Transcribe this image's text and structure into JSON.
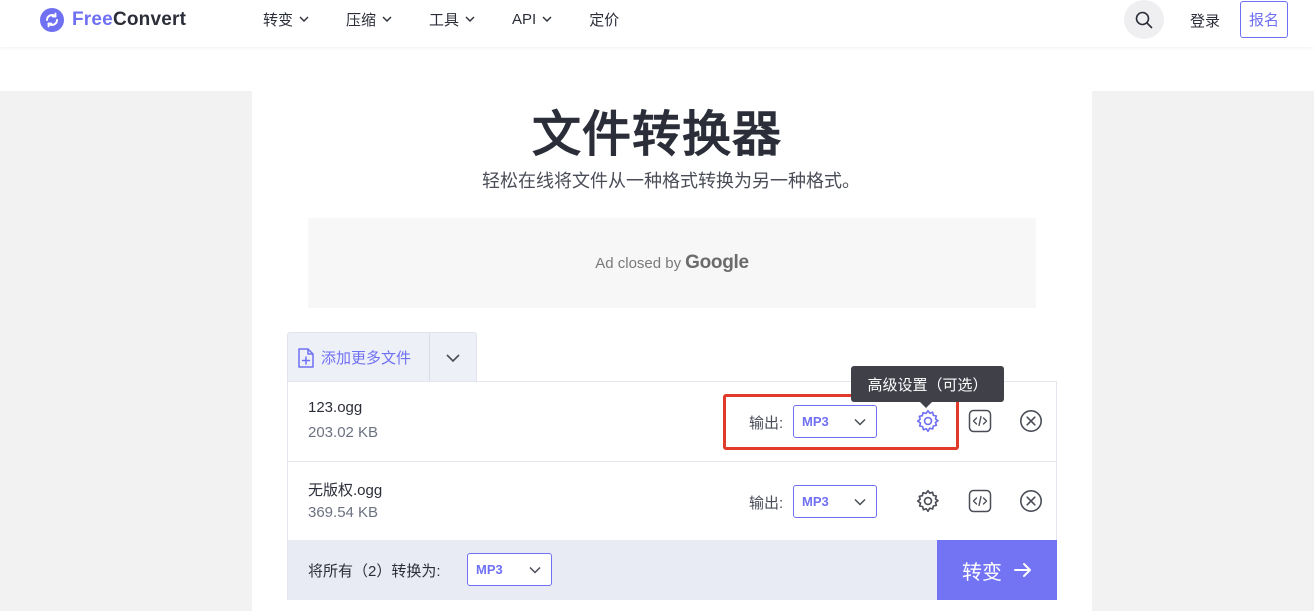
{
  "header": {
    "logo_free": "Free",
    "logo_convert": "Convert",
    "nav": [
      {
        "label": "转变"
      },
      {
        "label": "压缩"
      },
      {
        "label": "工具"
      },
      {
        "label": "API"
      },
      {
        "label": "定价"
      }
    ],
    "login": "登录",
    "signup": "报名"
  },
  "hero": {
    "title": "文件转换器",
    "subtitle": "轻松在线将文件从一种格式转换为另一种格式。"
  },
  "ad": {
    "text": "Ad closed by",
    "brand": "Google"
  },
  "add_files": {
    "label": "添加更多文件"
  },
  "files": [
    {
      "name": "123.ogg",
      "size": "203.02 KB",
      "output_label": "输出:",
      "format": "MP3"
    },
    {
      "name": "无版权.ogg",
      "size": "369.54 KB",
      "output_label": "输出:",
      "format": "MP3"
    }
  ],
  "tooltip": {
    "text": "高级设置（可选）"
  },
  "bottom": {
    "convert_all_label": "将所有（2）转换为:",
    "format": "MP3",
    "convert_button": "转变"
  },
  "colors": {
    "accent": "#6f70f2",
    "highlight": "#e03a2a"
  }
}
